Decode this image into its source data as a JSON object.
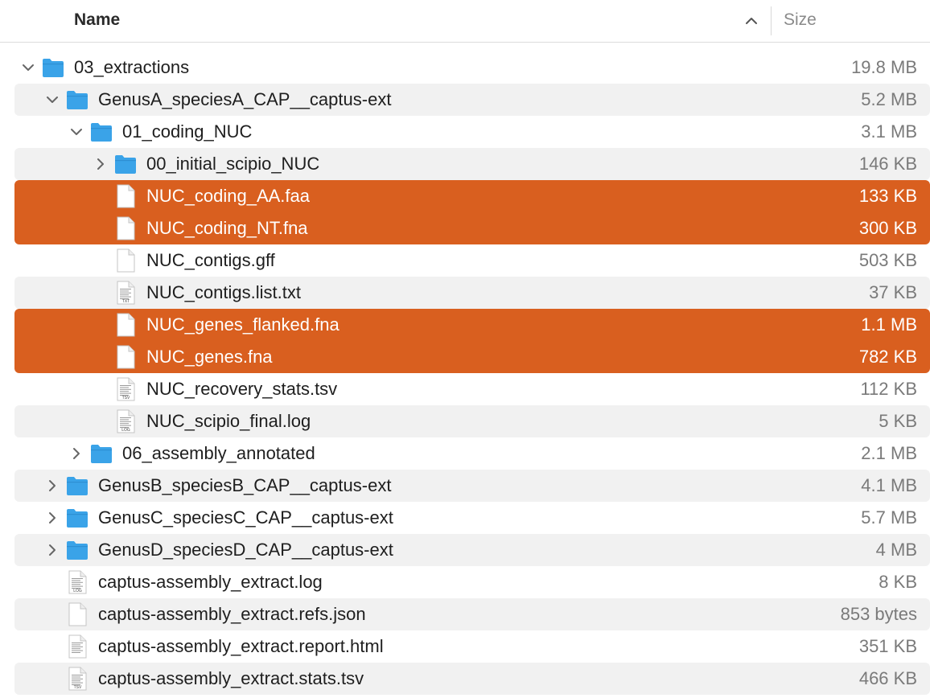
{
  "header": {
    "name_label": "Name",
    "size_label": "Size",
    "sort_icon": "chevron-up-icon"
  },
  "colors": {
    "selection": "#d95f1f",
    "folder": "#3aa3e8",
    "alt_row": "#f1f1f1"
  },
  "rows": [
    {
      "name": "03_extractions",
      "size": "19.8 MB",
      "kind": "folder",
      "depth": 0,
      "disclosure": "expanded",
      "selected": false
    },
    {
      "name": "GenusA_speciesA_CAP__captus-ext",
      "size": "5.2 MB",
      "kind": "folder",
      "depth": 1,
      "disclosure": "expanded",
      "selected": false
    },
    {
      "name": "01_coding_NUC",
      "size": "3.1 MB",
      "kind": "folder",
      "depth": 2,
      "disclosure": "expanded",
      "selected": false
    },
    {
      "name": "00_initial_scipio_NUC",
      "size": "146 KB",
      "kind": "folder",
      "depth": 3,
      "disclosure": "collapsed",
      "selected": false
    },
    {
      "name": "NUC_coding_AA.faa",
      "size": "133 KB",
      "kind": "file",
      "depth": 3,
      "disclosure": "none",
      "selected": true
    },
    {
      "name": "NUC_coding_NT.fna",
      "size": "300 KB",
      "kind": "file",
      "depth": 3,
      "disclosure": "none",
      "selected": true
    },
    {
      "name": "NUC_contigs.gff",
      "size": "503 KB",
      "kind": "file",
      "depth": 3,
      "disclosure": "none",
      "selected": false
    },
    {
      "name": "NUC_contigs.list.txt",
      "size": "37 KB",
      "kind": "text",
      "badge": "TXT",
      "depth": 3,
      "disclosure": "none",
      "selected": false
    },
    {
      "name": "NUC_genes_flanked.fna",
      "size": "1.1 MB",
      "kind": "file",
      "depth": 3,
      "disclosure": "none",
      "selected": true
    },
    {
      "name": "NUC_genes.fna",
      "size": "782 KB",
      "kind": "file",
      "depth": 3,
      "disclosure": "none",
      "selected": true
    },
    {
      "name": "NUC_recovery_stats.tsv",
      "size": "112 KB",
      "kind": "text",
      "badge": "TSV",
      "depth": 3,
      "disclosure": "none",
      "selected": false
    },
    {
      "name": "NUC_scipio_final.log",
      "size": "5 KB",
      "kind": "text",
      "badge": "LOG",
      "depth": 3,
      "disclosure": "none",
      "selected": false
    },
    {
      "name": "06_assembly_annotated",
      "size": "2.1 MB",
      "kind": "folder",
      "depth": 2,
      "disclosure": "collapsed",
      "selected": false
    },
    {
      "name": "GenusB_speciesB_CAP__captus-ext",
      "size": "4.1 MB",
      "kind": "folder",
      "depth": 1,
      "disclosure": "collapsed",
      "selected": false
    },
    {
      "name": "GenusC_speciesC_CAP__captus-ext",
      "size": "5.7 MB",
      "kind": "folder",
      "depth": 1,
      "disclosure": "collapsed",
      "selected": false
    },
    {
      "name": "GenusD_speciesD_CAP__captus-ext",
      "size": "4 MB",
      "kind": "folder",
      "depth": 1,
      "disclosure": "collapsed",
      "selected": false
    },
    {
      "name": "captus-assembly_extract.log",
      "size": "8 KB",
      "kind": "text",
      "badge": "LOG",
      "depth": 1,
      "disclosure": "none",
      "selected": false
    },
    {
      "name": "captus-assembly_extract.refs.json",
      "size": "853 bytes",
      "kind": "file",
      "depth": 1,
      "disclosure": "none",
      "selected": false
    },
    {
      "name": "captus-assembly_extract.report.html",
      "size": "351 KB",
      "kind": "html",
      "depth": 1,
      "disclosure": "none",
      "selected": false
    },
    {
      "name": "captus-assembly_extract.stats.tsv",
      "size": "466 KB",
      "kind": "text",
      "badge": "TSV",
      "depth": 1,
      "disclosure": "none",
      "selected": false
    }
  ]
}
